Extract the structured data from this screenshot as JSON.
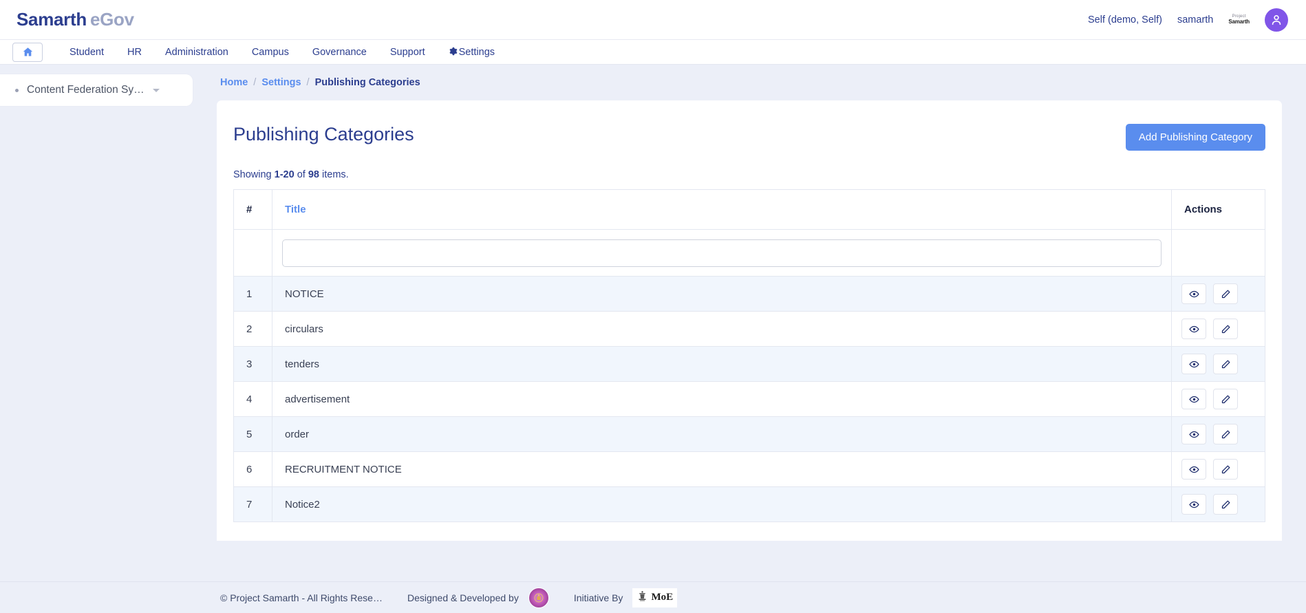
{
  "header": {
    "brand_primary": "Samarth",
    "brand_secondary": "eGov",
    "role_link": "Self (demo, Self)",
    "username": "samarth",
    "mini_logo_line1": "Project",
    "mini_logo_line2": "Samarth",
    "avatar_icon": "user-avatar-icon"
  },
  "nav": {
    "home_icon": "home-icon",
    "items": [
      {
        "label": "Student"
      },
      {
        "label": "HR"
      },
      {
        "label": "Administration"
      },
      {
        "label": "Campus"
      },
      {
        "label": "Governance"
      },
      {
        "label": "Support"
      },
      {
        "label": "Settings",
        "icon": "gear-icon"
      }
    ]
  },
  "sidebar": {
    "items": [
      {
        "label": "Content Federation Sy…"
      }
    ]
  },
  "breadcrumb": {
    "home": "Home",
    "sep": "/",
    "settings": "Settings",
    "current": "Publishing Categories"
  },
  "main": {
    "title": "Publishing Categories",
    "add_button": "Add Publishing Category",
    "showing_prefix": "Showing ",
    "showing_range": "1-20",
    "showing_mid": " of ",
    "showing_total": "98",
    "showing_suffix": " items."
  },
  "table": {
    "headers": {
      "num": "#",
      "title": "Title",
      "actions": "Actions"
    },
    "filter": {
      "title_value": "",
      "title_placeholder": ""
    },
    "rows": [
      {
        "num": "1",
        "title": "NOTICE"
      },
      {
        "num": "2",
        "title": "circulars"
      },
      {
        "num": "3",
        "title": "tenders"
      },
      {
        "num": "4",
        "title": "advertisement"
      },
      {
        "num": "5",
        "title": "order"
      },
      {
        "num": "6",
        "title": "RECRUITMENT NOTICE"
      },
      {
        "num": "7",
        "title": "Notice2"
      }
    ],
    "row_actions": {
      "view_icon": "eye-icon",
      "edit_icon": "pencil-icon"
    }
  },
  "footer": {
    "copyright": "© Project Samarth - All Rights Rese…",
    "designed_by": "Designed & Developed by",
    "designed_logo": "du-seal-icon",
    "initiative_by": "Initiative By",
    "initiative_logo": "moe-emblem-icon",
    "initiative_text": "MoE"
  },
  "colors": {
    "accent_blue": "#5a8dee",
    "brand_navy": "#2c3e8f",
    "avatar_purple": "#8055e8",
    "row_alt": "#f1f6fd",
    "page_bg": "#eceff8"
  }
}
